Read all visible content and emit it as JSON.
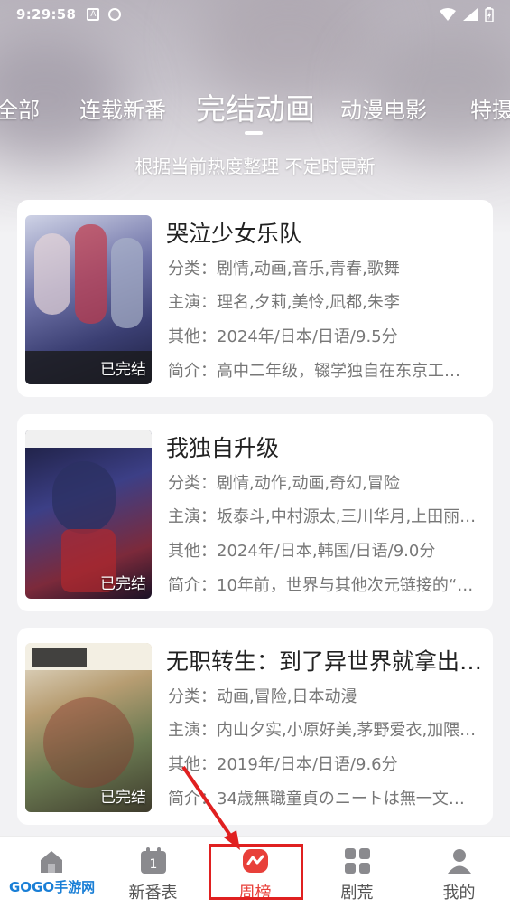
{
  "status_bar": {
    "time": "9:29:58"
  },
  "tabs": [
    {
      "label": "全部"
    },
    {
      "label": "连载新番"
    },
    {
      "label": "完结动画"
    },
    {
      "label": "动漫电影"
    },
    {
      "label": "特摄"
    }
  ],
  "subtitle": "根据当前热度整理 不定时更新",
  "cards": [
    {
      "title": "哭泣少女乐队",
      "category": "分类：剧情,动画,音乐,青春,歌舞",
      "cast": "主演：理名,夕莉,美怜,凪都,朱李",
      "other": "其他：2024年/日本/日语/9.5分",
      "summary": "简介：高中二年级，辍学独自在东京工…",
      "badge": "已完结"
    },
    {
      "title": "我独自升级",
      "category": "分类：剧情,动作,动画,奇幻,冒险",
      "cast": "主演：坂泰斗,中村源太,三川华月,上田丽…",
      "other": "其他：2024年/日本,韩国/日语/9.0分",
      "summary": "简介：10年前，世界与其他次元链接的“…",
      "badge": "已完结"
    },
    {
      "title": "无职转生：到了异世界就拿出…",
      "category": "分类：动画,冒险,日本动漫",
      "cast": "主演：内山夕实,小原好美,茅野爱衣,加隈…",
      "other": "其他：2019年/日本/日语/9.6分",
      "summary": "简介：34歳無職童貞のニートは無一文…",
      "badge": "已完结"
    }
  ],
  "bottom_nav": [
    {
      "label": "",
      "icon": "home-icon"
    },
    {
      "label": "新番表",
      "icon": "calendar-icon",
      "badge": "1"
    },
    {
      "label": "周榜",
      "icon": "trending-icon"
    },
    {
      "label": "剧荒",
      "icon": "grid-icon"
    },
    {
      "label": "我的",
      "icon": "profile-icon"
    }
  ],
  "watermark": "GOGO手游网",
  "colors": {
    "accent": "#e8403a",
    "highlight": "#e02020"
  }
}
